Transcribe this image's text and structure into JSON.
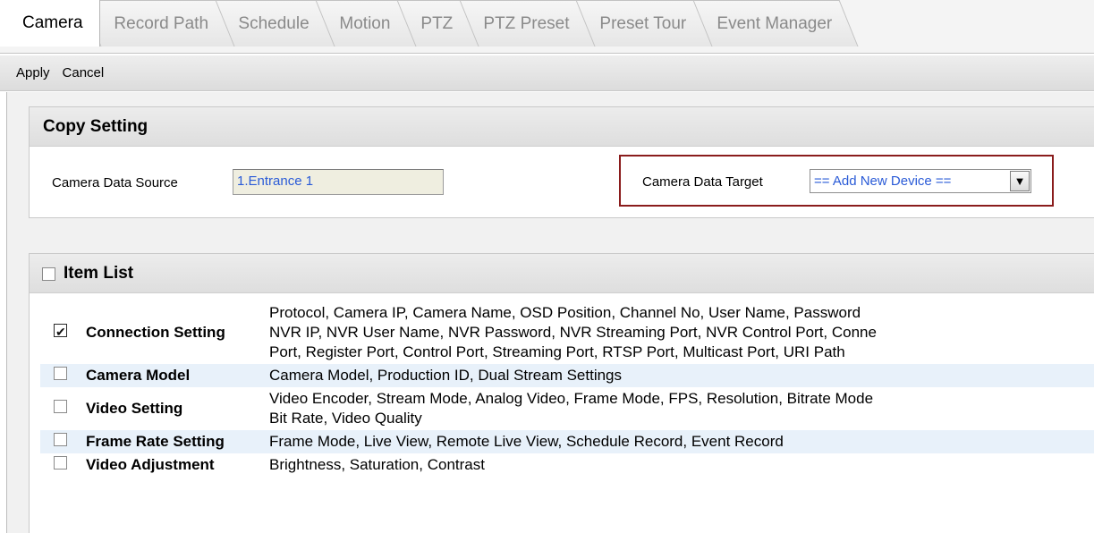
{
  "tabs": [
    {
      "label": "Camera",
      "active": true
    },
    {
      "label": "Record Path",
      "active": false
    },
    {
      "label": "Schedule",
      "active": false
    },
    {
      "label": "Motion",
      "active": false
    },
    {
      "label": "PTZ",
      "active": false
    },
    {
      "label": "PTZ Preset",
      "active": false
    },
    {
      "label": "Preset Tour",
      "active": false
    },
    {
      "label": "Event Manager",
      "active": false
    }
  ],
  "toolbar": {
    "apply_label": "Apply",
    "cancel_label": "Cancel"
  },
  "copy_setting": {
    "title": "Copy Setting",
    "source_label": "Camera Data Source",
    "source_value": "1.Entrance 1",
    "target_label": "Camera Data Target",
    "target_value": "== Add New Device =="
  },
  "item_list": {
    "title": "Item List",
    "items": [
      {
        "name": "Connection Setting",
        "checked": true,
        "desc": [
          "Protocol, Camera IP, Camera Name, OSD Position, Channel No, User Name, Password",
          "NVR IP, NVR User Name, NVR Password, NVR Streaming Port, NVR Control Port, Conne",
          "Port, Register Port, Control Port, Streaming Port, RTSP Port, Multicast Port, URI Path"
        ]
      },
      {
        "name": "Camera Model",
        "checked": false,
        "desc": [
          "Camera Model, Production ID, Dual Stream Settings"
        ]
      },
      {
        "name": "Video Setting",
        "checked": false,
        "desc": [
          "Video Encoder, Stream Mode, Analog Video, Frame Mode, FPS, Resolution, Bitrate Mode",
          "Bit Rate, Video Quality"
        ]
      },
      {
        "name": "Frame Rate Setting",
        "checked": false,
        "desc": [
          "Frame Mode, Live View, Remote Live View, Schedule Record, Event Record"
        ]
      },
      {
        "name": "Video Adjustment",
        "checked": false,
        "desc": [
          "Brightness, Saturation, Contrast"
        ]
      }
    ]
  }
}
